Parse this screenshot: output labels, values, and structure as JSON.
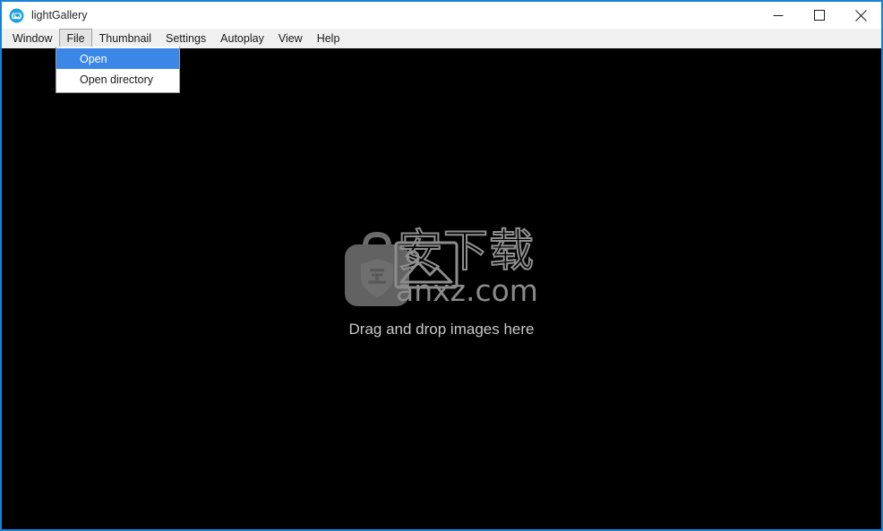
{
  "window": {
    "title": "lightGallery",
    "icon": "gallery-app-icon",
    "accent_color": "#1683d8",
    "background_color": "#000000",
    "controls": [
      {
        "name": "minimize",
        "glyph": "minimize-icon"
      },
      {
        "name": "maximize",
        "glyph": "maximize-icon"
      },
      {
        "name": "close",
        "glyph": "close-icon"
      }
    ]
  },
  "menubar": {
    "items": [
      {
        "label": "Window",
        "active": false
      },
      {
        "label": "File",
        "active": true
      },
      {
        "label": "Thumbnail",
        "active": false
      },
      {
        "label": "Settings",
        "active": false
      },
      {
        "label": "Autoplay",
        "active": false
      },
      {
        "label": "View",
        "active": false
      },
      {
        "label": "Help",
        "active": false
      }
    ]
  },
  "dropdown": {
    "owner": "File",
    "highlight_color": "#3a87e8",
    "items": [
      {
        "label": "Open",
        "selected": true
      },
      {
        "label": "Open directory",
        "selected": false
      }
    ]
  },
  "content": {
    "empty_state_text": "Drag and drop images here",
    "empty_state_icon": "briefcase-shield-icon",
    "watermark": {
      "characters": "安下载",
      "url": "anxz.com",
      "photo_icon": "image-placeholder-icon"
    }
  }
}
